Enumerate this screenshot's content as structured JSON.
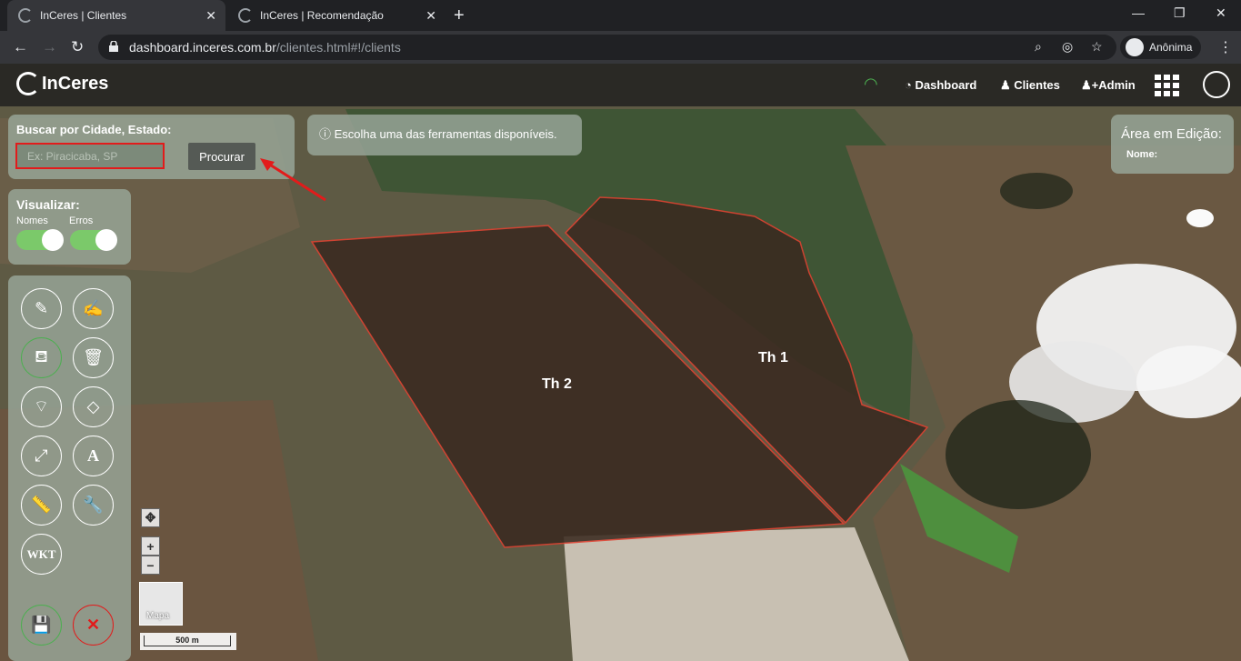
{
  "browser": {
    "tabs": [
      {
        "title": "InCeres | Clientes",
        "active": true
      },
      {
        "title": "InCeres | Recomendação",
        "active": false
      }
    ],
    "url_host": "dashboard.inceres.com.br",
    "url_path": "/clientes.html#!/clients",
    "profile_label": "Anônima"
  },
  "nav": {
    "brand": "InCeres",
    "dashboard": "Dashboard",
    "clients": "Clientes",
    "admin": "Admin"
  },
  "search": {
    "label": "Buscar por Cidade, Estado:",
    "placeholder": "Ex: Piracicaba, SP",
    "button": "Procurar"
  },
  "help": {
    "text": "Escolha uma das ferramentas disponíveis."
  },
  "edit_area": {
    "title": "Área em Edição:",
    "name_label": "Nome:"
  },
  "view": {
    "title": "Visualizar:",
    "names_label": "Nomes",
    "errors_label": "Erros",
    "names_on": true,
    "errors_on": true
  },
  "tools": {
    "wkt_label": "WKT",
    "text_tool_label": "A",
    "cancel_label": "✕"
  },
  "fields": [
    {
      "name": "Th 2"
    },
    {
      "name": "Th 1"
    }
  ],
  "map": {
    "layer_label": "Mapa",
    "scale_label": "500 m",
    "zoom_in": "+",
    "zoom_out": "−"
  },
  "colors": {
    "accent_green": "#4caf50",
    "alert_red": "#e21b1b"
  }
}
